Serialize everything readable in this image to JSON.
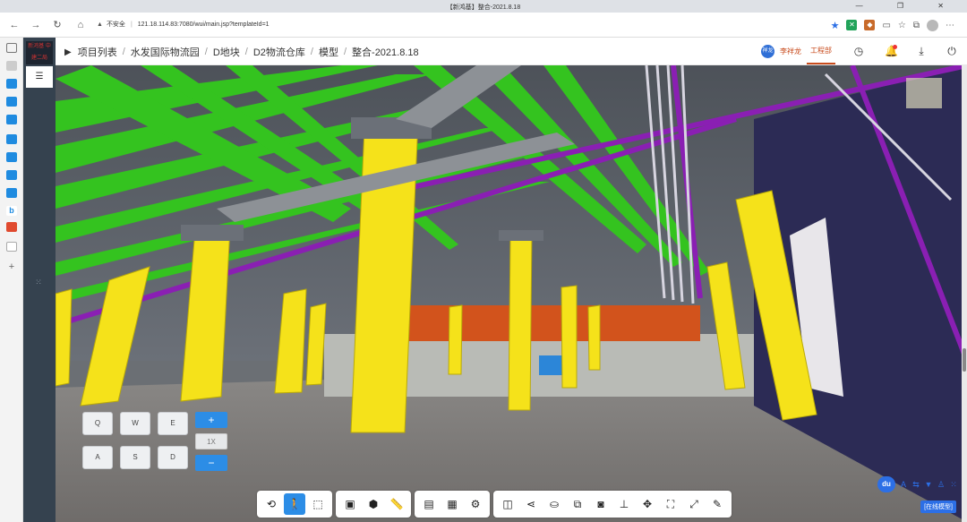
{
  "browser": {
    "tab_title": "【新鸿基】整合-2021.8.18",
    "security_label": "不安全",
    "url": "121.18.114.83:7080/wui/main.jsp?templateId=1",
    "window_controls": "— ❐ ✕"
  },
  "app": {
    "logo_text": "新鸿基 中建二局",
    "menu_icon": "menu-icon"
  },
  "breadcrumb": {
    "items": [
      "项目列表",
      "水发国际物流园",
      "D地块",
      "D2物流仓库",
      "模型",
      "整合-2021.8.18"
    ]
  },
  "user": {
    "avatar_text": "祥龙",
    "name": "李祥龙",
    "department": "工程部"
  },
  "navpad": {
    "q": "Q",
    "w": "W",
    "e": "E",
    "a": "A",
    "s": "S",
    "d": "D"
  },
  "speed": {
    "plus": "+",
    "value": "1X",
    "minus": "−"
  },
  "status": {
    "du": "du",
    "online_mode": "[在线模型]"
  },
  "colors": {
    "accent": "#2c8de6",
    "user_red": "#c84b1c",
    "sidebar": "#35424f",
    "column_yellow": "#f5e21a",
    "beam_green": "#34c31f",
    "pipe_purple": "#8a1fb3",
    "wall_orange": "#d2531c"
  }
}
